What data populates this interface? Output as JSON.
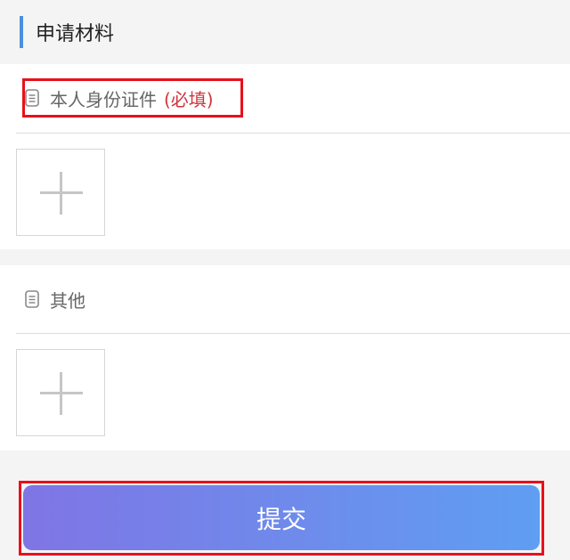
{
  "section": {
    "title": "申请材料"
  },
  "materials": [
    {
      "label": "本人身份证件",
      "required_mark": "(必填)"
    },
    {
      "label": "其他"
    }
  ],
  "submit": {
    "label": "提交"
  },
  "colors": {
    "accent_bar": "#4a90e2",
    "required": "#d0353d",
    "highlight_outline": "#e8101b",
    "button_gradient_start": "#7f75e4",
    "button_gradient_end": "#5f9ef2"
  },
  "icons": {
    "material_icon": "document-icon",
    "upload_icon": "plus-icon"
  }
}
